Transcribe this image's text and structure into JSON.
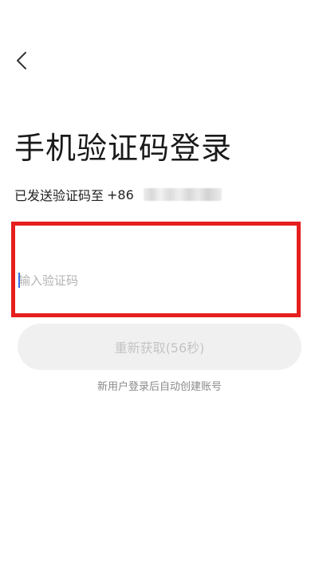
{
  "header": {
    "back_icon": "chevron-left-icon"
  },
  "main": {
    "title": "手机验证码登录",
    "sent_prefix": "已发送验证码至",
    "country_code": "+86",
    "code_input": {
      "value": "",
      "placeholder": "输入验证码"
    },
    "resend_button_label": "重新获取(56秒)",
    "new_user_hint": "新用户登录后自动创建账号"
  },
  "colors": {
    "highlight_border": "#e61e1e",
    "caret": "#3a6ee8",
    "disabled_button_bg": "#f0f0f0",
    "disabled_button_text": "#c4c4c4"
  }
}
